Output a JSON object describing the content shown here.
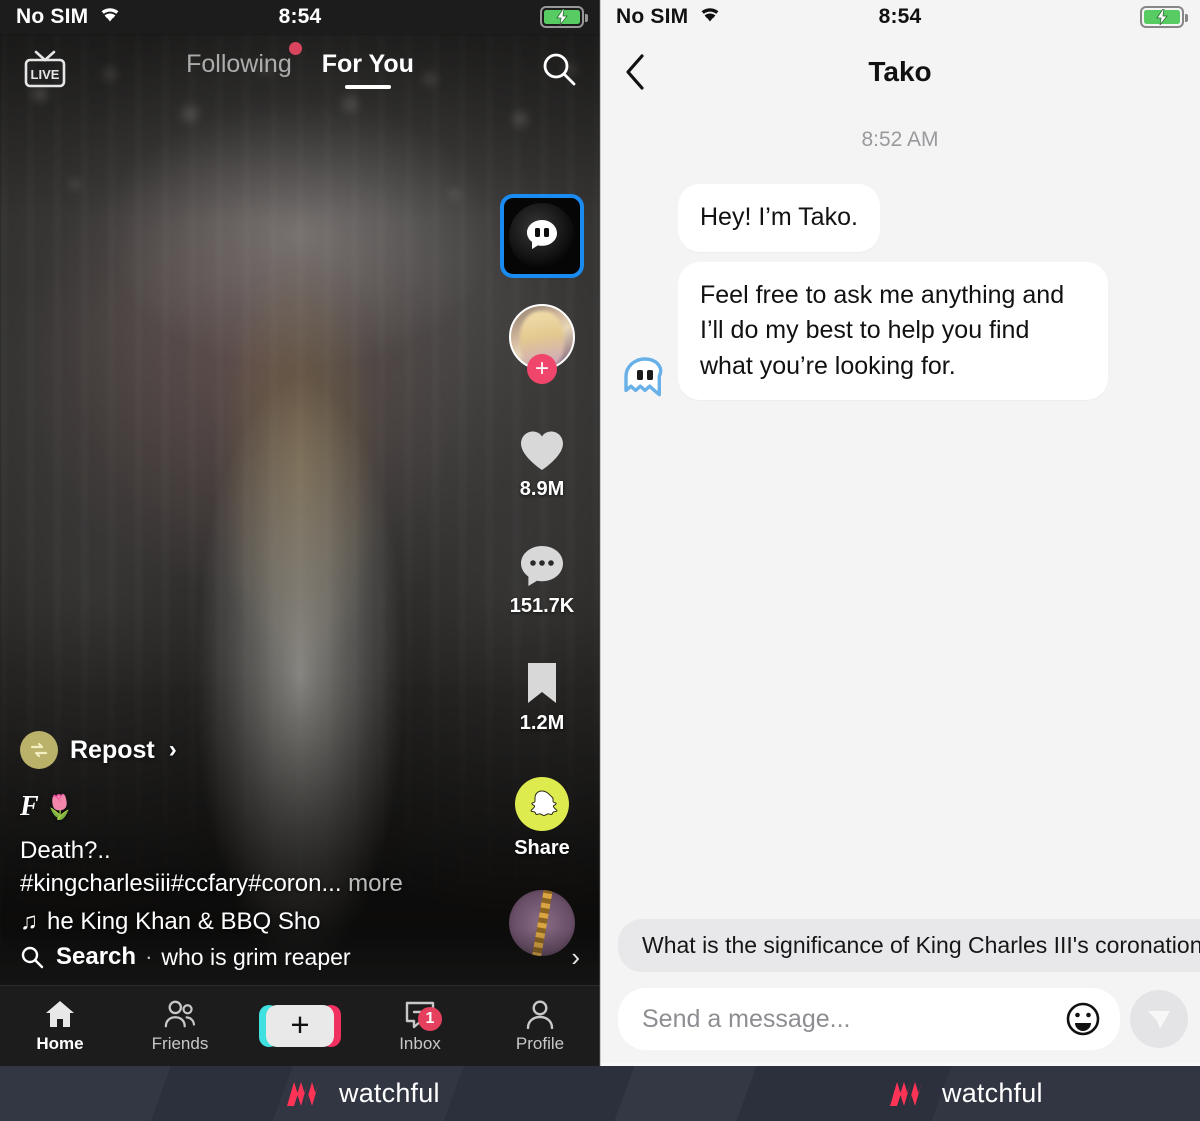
{
  "left_panel": {
    "status_bar": {
      "carrier": "No SIM",
      "time": "8:54",
      "wifi_icon": "wifi-icon",
      "battery_icon": "battery-charging-icon"
    },
    "top_nav": {
      "live_icon": "live-tv-icon",
      "search_icon": "search-icon",
      "tabs": [
        {
          "label": "Following",
          "active": false,
          "has_dot": true
        },
        {
          "label": "For You",
          "active": true,
          "has_dot": false
        }
      ]
    },
    "action_rail": {
      "tako_button": {
        "icon": "tako-ghost-icon",
        "highlighted": true,
        "highlight_color": "#1a8bf0"
      },
      "author_avatar": {
        "icon": "avatar",
        "follow_icon": "plus-icon"
      },
      "like": {
        "icon": "heart-icon",
        "count": "8.9M"
      },
      "comment": {
        "icon": "comment-icon",
        "count": "151.7K"
      },
      "bookmark": {
        "icon": "bookmark-icon",
        "count": "1.2M"
      },
      "share": {
        "icon": "snapchat-icon",
        "label": "Share",
        "color": "#ddeb4e"
      },
      "music_disc": {
        "icon": "music-disc-icon"
      }
    },
    "caption": {
      "repost_icon": "repost-icon",
      "repost_label": "Repost",
      "repost_chevron": "chevron-right-icon",
      "handle_mark": "F",
      "handle_emoji": "🌷",
      "text_line": "Death?..",
      "hashtags": "#kingcharlesiii#ccfary#coron...",
      "more_label": "more",
      "music_icon": "music-note-icon",
      "music_title": "he King Khan & BBQ Sho"
    },
    "feed_search": {
      "icon": "search-icon",
      "label": "Search",
      "separator": "·",
      "query": "who is grim reaper",
      "chevron": "chevron-right-icon"
    },
    "tab_bar": [
      {
        "label": "Home",
        "icon": "home-icon",
        "active": true,
        "badge": ""
      },
      {
        "label": "Friends",
        "icon": "friends-icon",
        "active": false,
        "badge": ""
      },
      {
        "label": "",
        "icon": "create-plus-icon",
        "active": false,
        "badge": ""
      },
      {
        "label": "Inbox",
        "icon": "inbox-icon",
        "active": false,
        "badge": "1"
      },
      {
        "label": "Profile",
        "icon": "profile-icon",
        "active": false,
        "badge": ""
      }
    ]
  },
  "right_panel": {
    "status_bar": {
      "carrier": "No SIM",
      "time": "8:54",
      "wifi_icon": "wifi-icon",
      "battery_icon": "battery-charging-icon"
    },
    "header": {
      "back_icon": "back-chevron-icon",
      "title": "Tako"
    },
    "conversation": {
      "timestamp": "8:52 AM",
      "messages": [
        {
          "sender": "Tako",
          "text": "Hey! I’m Tako.",
          "show_avatar": false
        },
        {
          "sender": "Tako",
          "text": "Feel free to ask me anything and I’ll do my best to help you find what you’re looking for.",
          "show_avatar": true,
          "avatar_icon": "tako-ghost-icon"
        }
      ]
    },
    "suggestion_chip": "What is the significance of King Charles III's coronation",
    "composer": {
      "placeholder": "Send a message...",
      "emoji_icon": "emoji-smiley-icon",
      "send_icon": "send-arrow-icon"
    }
  },
  "footer": {
    "watermark_left": "watchful",
    "watermark_right": "watchful",
    "mark_icon": "watchful-logo-icon",
    "mark_color": "#ff3355"
  }
}
